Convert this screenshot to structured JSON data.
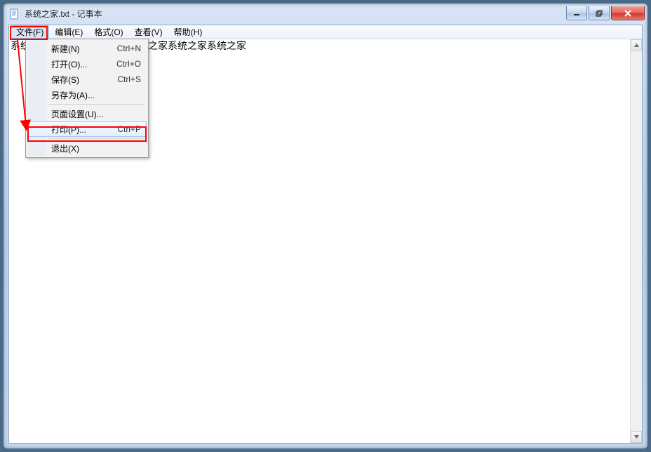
{
  "title": "系统之家.txt - 记事本",
  "menubar": [
    {
      "label": "文件(F)",
      "opened": true
    },
    {
      "label": "编辑(E)"
    },
    {
      "label": "格式(O)"
    },
    {
      "label": "查看(V)"
    },
    {
      "label": "帮助(H)"
    }
  ],
  "file_menu": {
    "items": [
      {
        "label": "新建(N)",
        "accel": "Ctrl+N"
      },
      {
        "label": "打开(O)...",
        "accel": "Ctrl+O"
      },
      {
        "label": "保存(S)",
        "accel": "Ctrl+S"
      },
      {
        "label": "另存为(A)...",
        "accel": ""
      },
      {
        "sep": true
      },
      {
        "label": "页面设置(U)...",
        "accel": ""
      },
      {
        "label": "打印(P)...",
        "accel": "Ctrl+P",
        "hover": true
      },
      {
        "sep": true
      },
      {
        "label": "退出(X)",
        "accel": ""
      }
    ]
  },
  "editor_text": "系统之家系统之家系统之家系统之家系统之家系统之家"
}
